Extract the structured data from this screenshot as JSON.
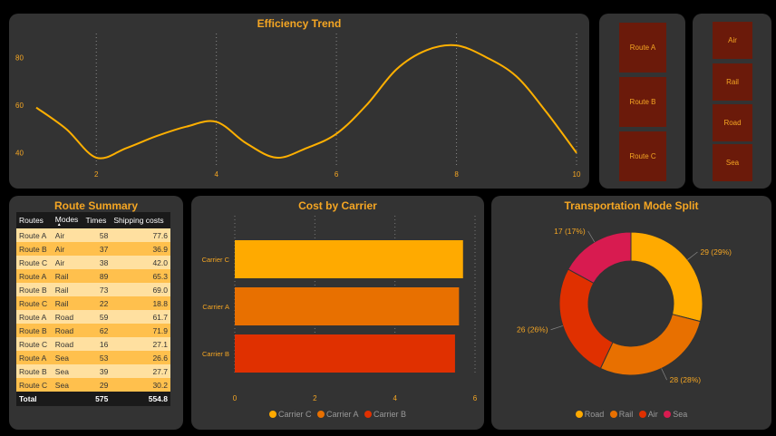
{
  "colors": {
    "accent": "#F5A623",
    "panel": "#333333",
    "road": "#FFAA00",
    "rail": "#E87000",
    "air": "#E03000",
    "sea": "#D81B50",
    "slicer": "#6B1A0A"
  },
  "trend": {
    "title": "Efficiency Trend",
    "x": [
      1,
      1.5,
      2,
      2.5,
      3,
      3.5,
      4,
      4.5,
      5,
      5.5,
      6,
      6.5,
      7,
      7.5,
      8,
      8.5,
      9,
      9.5,
      10
    ],
    "y": [
      59,
      50,
      38,
      42,
      47,
      51,
      53,
      44,
      38,
      42,
      48,
      60,
      75,
      83,
      85,
      80,
      72,
      57,
      40
    ],
    "xticks": [
      "2",
      "4",
      "6",
      "8",
      "10"
    ],
    "yticks": [
      "40",
      "60",
      "80"
    ]
  },
  "route_slicer": {
    "items": [
      "Route A",
      "Route B",
      "Route C"
    ]
  },
  "mode_slicer": {
    "items": [
      "Air",
      "Rail",
      "Road",
      "Sea"
    ]
  },
  "summary": {
    "title": "Route Summary",
    "headers": [
      "Routes",
      "Modes",
      "Times",
      "Shipping costs"
    ],
    "rows": [
      [
        "Route A",
        "Air",
        "58",
        "77.6"
      ],
      [
        "Route B",
        "Air",
        "37",
        "36.9"
      ],
      [
        "Route C",
        "Air",
        "38",
        "42.0"
      ],
      [
        "Route A",
        "Rail",
        "89",
        "65.3"
      ],
      [
        "Route B",
        "Rail",
        "73",
        "69.0"
      ],
      [
        "Route C",
        "Rail",
        "22",
        "18.8"
      ],
      [
        "Route A",
        "Road",
        "59",
        "61.7"
      ],
      [
        "Route B",
        "Road",
        "62",
        "71.9"
      ],
      [
        "Route C",
        "Road",
        "16",
        "27.1"
      ],
      [
        "Route A",
        "Sea",
        "53",
        "26.6"
      ],
      [
        "Route B",
        "Sea",
        "39",
        "27.7"
      ],
      [
        "Route C",
        "Sea",
        "29",
        "30.2"
      ]
    ],
    "total": [
      "Total",
      "",
      "575",
      "554.8"
    ]
  },
  "chart_data": [
    {
      "type": "line",
      "title": "Efficiency Trend",
      "x": [
        1,
        1.5,
        2,
        2.5,
        3,
        3.5,
        4,
        4.5,
        5,
        5.5,
        6,
        6.5,
        7,
        7.5,
        8,
        8.5,
        9,
        9.5,
        10
      ],
      "y": [
        59,
        50,
        38,
        42,
        47,
        51,
        53,
        44,
        38,
        42,
        48,
        60,
        75,
        83,
        85,
        80,
        72,
        57,
        40
      ],
      "xlim": [
        1,
        10
      ],
      "ylim": [
        30,
        90
      ]
    },
    {
      "type": "bar",
      "title": "Cost by Carrier",
      "categories": [
        "Carrier C",
        "Carrier A",
        "Carrier B"
      ],
      "values": [
        5.7,
        5.6,
        5.5
      ],
      "xlim": [
        0,
        6
      ],
      "xticks": [
        "0",
        "2",
        "4",
        "6"
      ],
      "legend": [
        "Carrier C",
        "Carrier A",
        "Carrier B"
      ]
    },
    {
      "type": "pie",
      "title": "Transportation Mode Split",
      "categories": [
        "Road",
        "Rail",
        "Air",
        "Sea"
      ],
      "values": [
        29,
        28,
        26,
        17
      ],
      "labels": [
        "29 (29%)",
        "28 (28%)",
        "26 (26%)",
        "17 (17%)"
      ],
      "legend": [
        "Road",
        "Rail",
        "Air",
        "Sea"
      ]
    }
  ]
}
